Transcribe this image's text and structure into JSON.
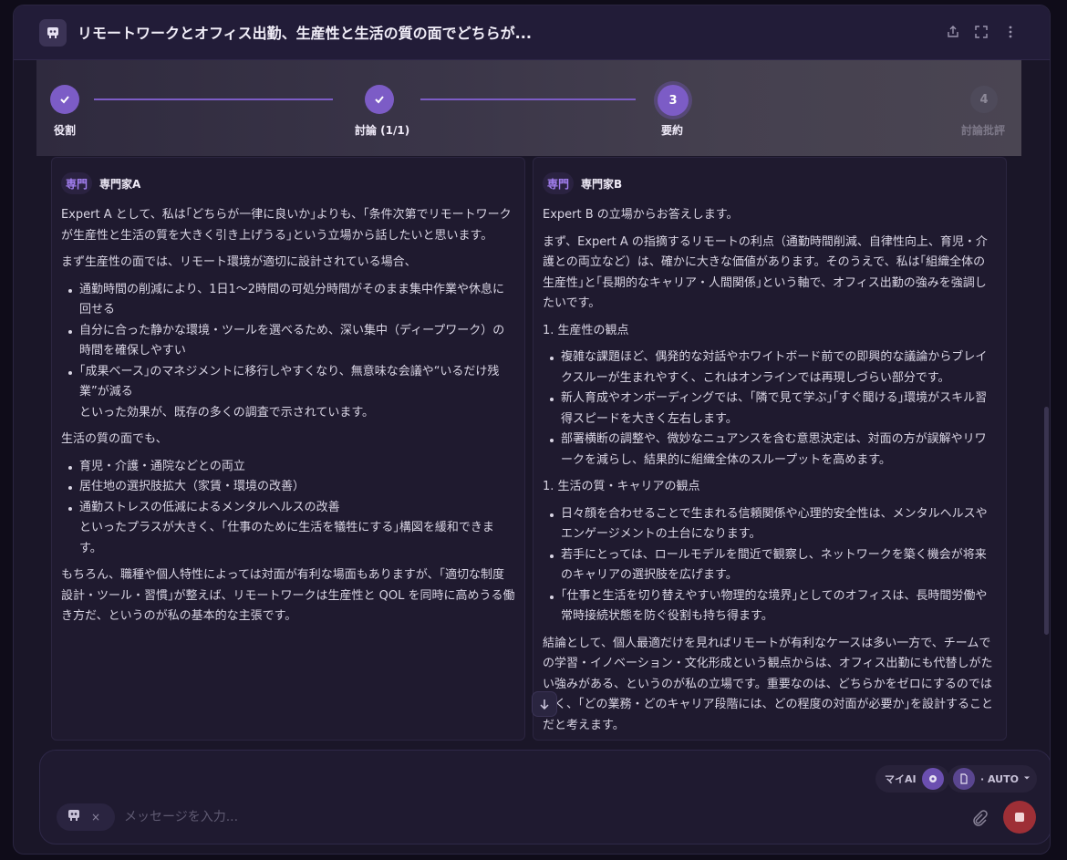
{
  "header": {
    "title": "リモートワークとオフィス出勤、生産性と生活の質の面でどちらが...",
    "icons": [
      "robot-icon",
      "share-icon",
      "expand-icon",
      "more-icon"
    ]
  },
  "stepper": {
    "steps": [
      {
        "label": "役割",
        "state": "done"
      },
      {
        "label": "討論 (1/1)",
        "state": "done"
      },
      {
        "label": "要約",
        "number": "3",
        "state": "active"
      },
      {
        "label": "討論批評",
        "number": "4",
        "state": "pending"
      }
    ]
  },
  "panels": [
    {
      "badge": "専門",
      "name": "専門家A",
      "blocks": [
        {
          "type": "p",
          "text": "Expert A として、私は｢どちらが一律に良いか｣よりも、｢条件次第でリモートワークが生産性と生活の質を大きく引き上げうる｣という立場から話したいと思います。"
        },
        {
          "type": "p",
          "text": "まず生産性の面では、リモート環境が適切に設計されている場合、"
        },
        {
          "type": "ul",
          "items": [
            "通勤時間の削減により、1日1〜2時間の可処分時間がそのまま集中作業や休息に回せる",
            "自分に合った静かな環境・ツールを選べるため、深い集中（ディープワーク）の時間を確保しやすい",
            "｢成果ベース｣のマネジメントに移行しやすくなり、無意味な会議や“いるだけ残業”が減る\nといった効果が、既存の多くの調査で示されています。"
          ]
        },
        {
          "type": "p",
          "text": "生活の質の面でも、"
        },
        {
          "type": "ul",
          "items": [
            "育児・介護・通院などとの両立",
            "居住地の選択肢拡大（家賃・環境の改善）",
            "通勤ストレスの低減によるメンタルヘルスの改善\nといったプラスが大きく、｢仕事のために生活を犠牲にする｣構図を緩和できます。"
          ]
        },
        {
          "type": "p",
          "text": "もちろん、職種や個人特性によっては対面が有利な場面もありますが、｢適切な制度設計・ツール・習慣｣が整えば、リモートワークは生産性と QOL を同時に高めうる働き方だ、というのが私の基本的な主張です。"
        }
      ]
    },
    {
      "badge": "専門",
      "name": "専門家B",
      "blocks": [
        {
          "type": "p",
          "text": "Expert B の立場からお答えします。"
        },
        {
          "type": "p",
          "text": "まず、Expert A の指摘するリモートの利点（通勤時間削減、自律性向上、育児・介護との両立など）は、確かに大きな価値があります。そのうえで、私は｢組織全体の生産性｣と｢長期的なキャリア・人間関係｣という軸で、オフィス出勤の強みを強調したいです。"
        },
        {
          "type": "p",
          "text": "1. 生産性の観点"
        },
        {
          "type": "ul",
          "items": [
            "複雑な課題ほど、偶発的な対話やホワイトボード前での即興的な議論からブレイクスルーが生まれやすく、これはオンラインでは再現しづらい部分です。",
            "新人育成やオンボーディングでは、｢隣で見て学ぶ｣｢すぐ聞ける｣環境がスキル習得スピードを大きく左右します。",
            "部署横断の調整や、微妙なニュアンスを含む意思決定は、対面の方が誤解やリワークを減らし、結果的に組織全体のスループットを高めます。"
          ]
        },
        {
          "type": "p",
          "text": "1. 生活の質・キャリアの観点"
        },
        {
          "type": "ul",
          "items": [
            "日々顔を合わせることで生まれる信頼関係や心理的安全性は、メンタルヘルスやエンゲージメントの土台になります。",
            "若手にとっては、ロールモデルを間近で観察し、ネットワークを築く機会が将来のキャリアの選択肢を広げます。",
            "｢仕事と生活を切り替えやすい物理的な境界｣としてのオフィスは、長時間労働や常時接続状態を防ぐ役割も持ち得ます。"
          ]
        },
        {
          "type": "p",
          "text": "結論として、個人最適だけを見ればリモートが有利なケースは多い一方で、チームでの学習・イノベーション・文化形成という観点からは、オフィス出勤にも代替しがたい強みがある、というのが私の立場です。重要なのは、どちらかをゼロにするのではなく、｢どの業務・どのキャリア段階には、どの程度の対面が必要か｣を設計することだと考えます。"
        }
      ]
    }
  ],
  "composer": {
    "my_ai_label": "マイAI",
    "mode_label": "· AUTO",
    "placeholder": "メッセージを入力...",
    "chip_close": "×"
  },
  "colors": {
    "accent": "#7c5cc6",
    "badge_text": "#a27ff0",
    "stop": "#9e2f36",
    "background": "#1a1628"
  }
}
